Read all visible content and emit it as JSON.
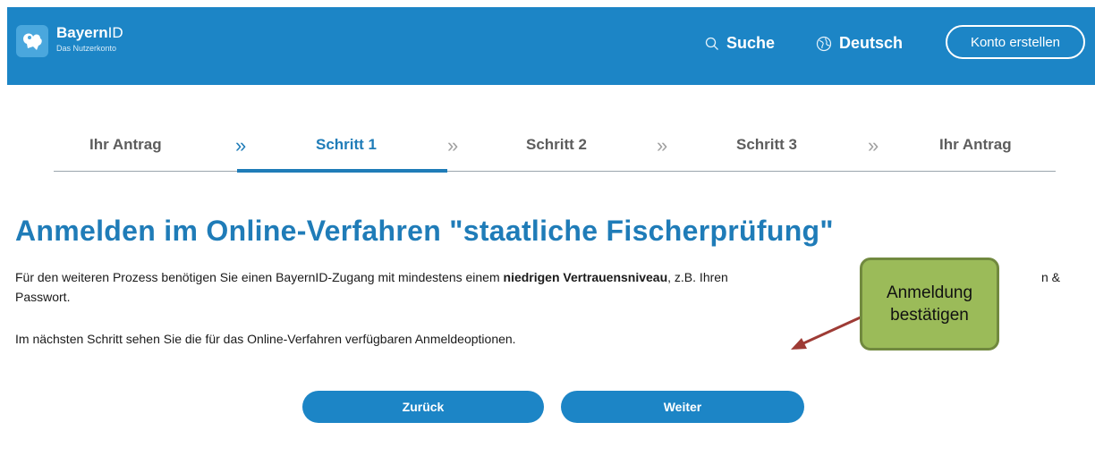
{
  "header": {
    "logo_name_bold": "Bayern",
    "logo_name_light": "ID",
    "logo_sub": "Das Nutzerkonto",
    "search_label": "Suche",
    "language_label": "Deutsch",
    "konto_label": "Konto erstellen"
  },
  "stepper": {
    "steps": [
      {
        "label": "Ihr Antrag"
      },
      {
        "label": "Schritt 1"
      },
      {
        "label": "Schritt 2"
      },
      {
        "label": "Schritt 3"
      },
      {
        "label": "Ihr Antrag"
      }
    ],
    "chevron": "»",
    "active_index": 1
  },
  "main": {
    "title": "Anmelden im Online-Verfahren \"staatliche Fischerprüfung\"",
    "para1_before": "Für den weiteren Prozess benötigen Sie einen BayernID-Zugang mit mindestens einem ",
    "para1_bold": "niedrigen Vertrauensniveau",
    "para1_after": ", z.B. Ihren",
    "para1_tail": "n &",
    "para1_line2": "Passwort.",
    "para2": "Im nächsten Schritt sehen Sie die für das Online-Verfahren verfügbaren Anmeldeoptionen.",
    "back_label": "Zurück",
    "next_label": "Weiter"
  },
  "annotation": {
    "line1": "Anmeldung",
    "line2": "bestätigen"
  },
  "colors": {
    "brand_blue": "#1c85c6",
    "callout_green": "#9bbb59",
    "arrow_red": "#9e3b35"
  }
}
